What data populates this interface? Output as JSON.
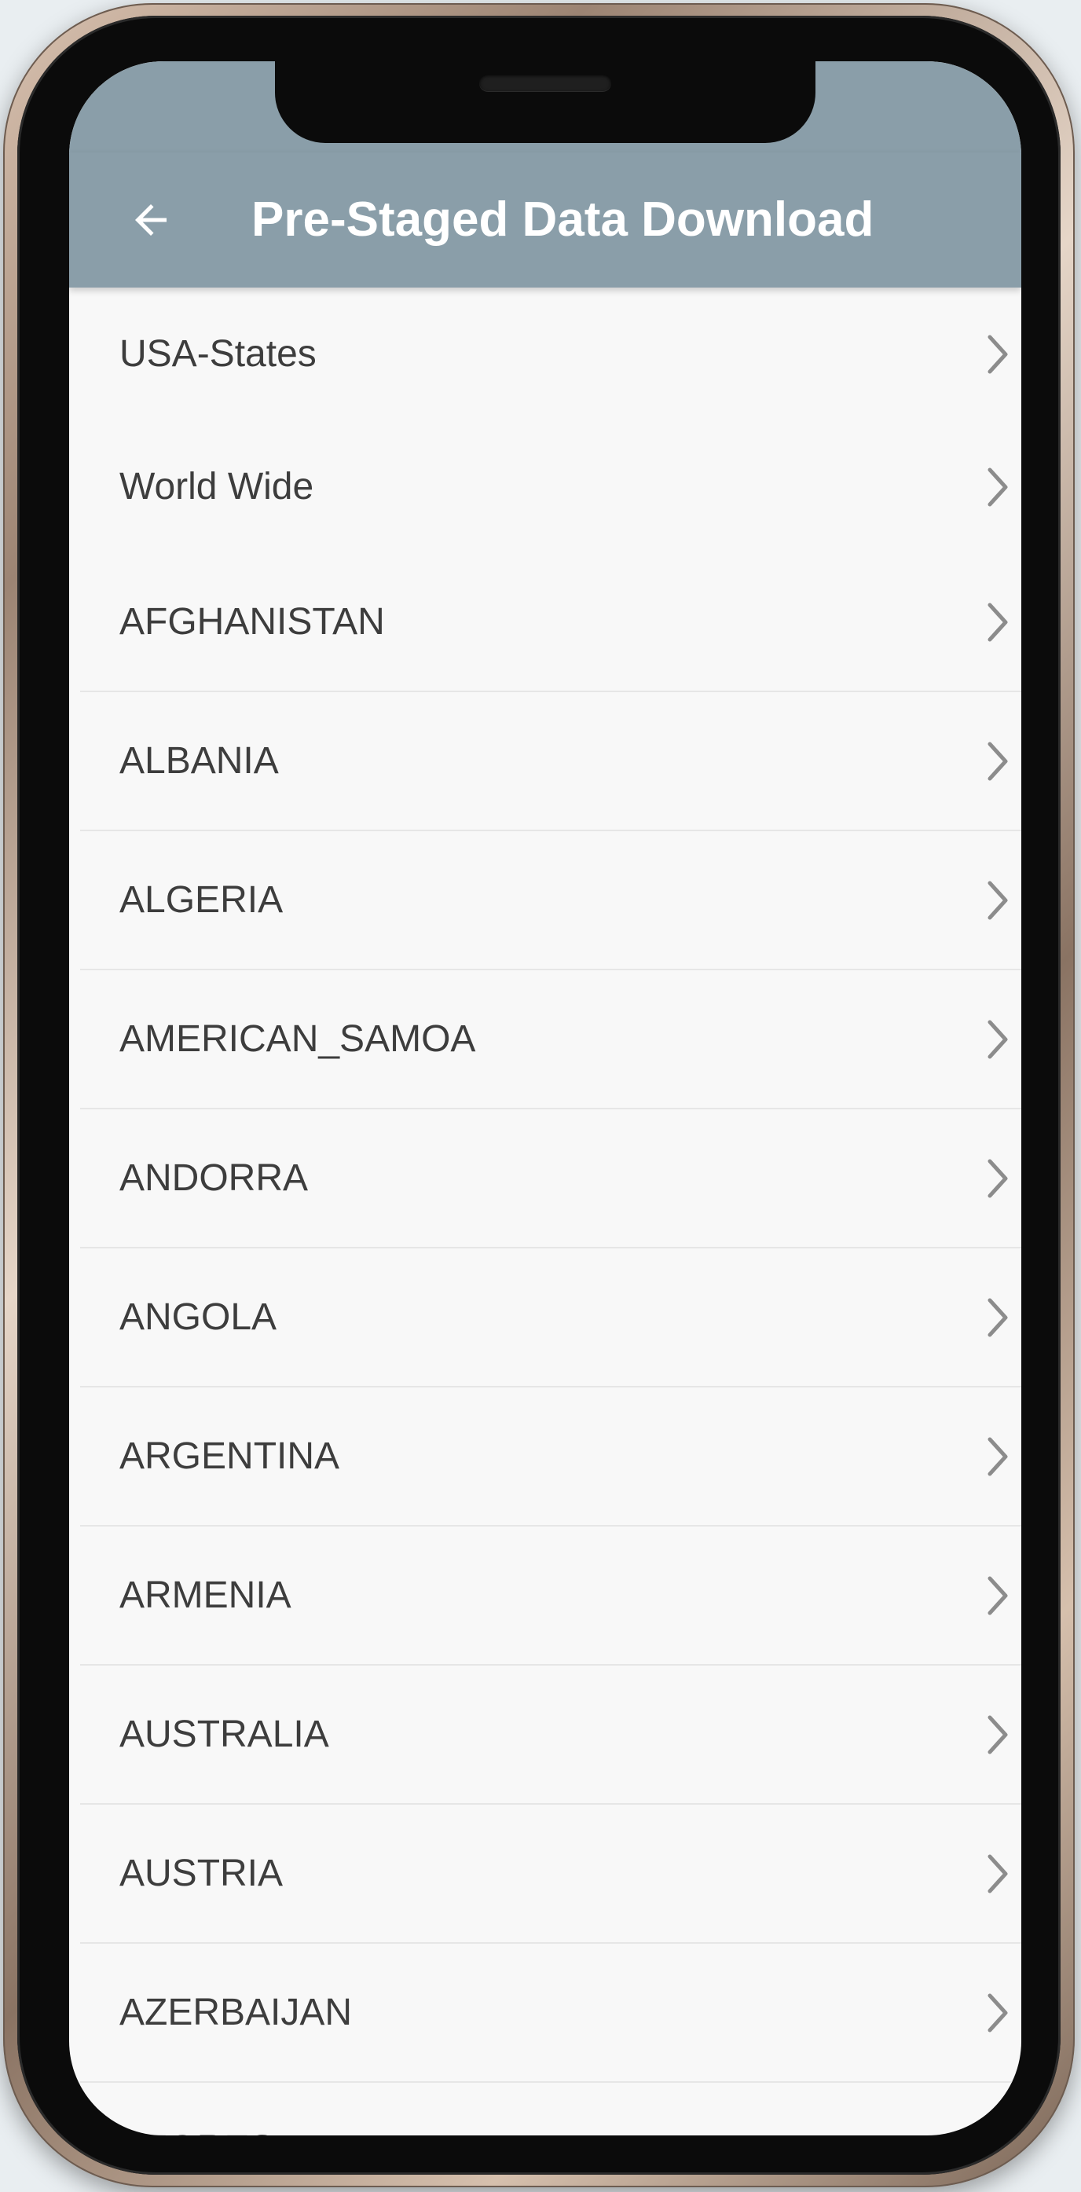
{
  "app_bar": {
    "title": "Pre-Staged Data Download",
    "back_icon": "arrow-back-icon"
  },
  "colors": {
    "app_bar": "#8a9ea9",
    "list_bg": "#f8f8f8",
    "text": "#3d3d3d",
    "chevron": "#8c8c8c"
  },
  "list": {
    "items": [
      {
        "label": "USA-States"
      },
      {
        "label": "World Wide"
      },
      {
        "label": "AFGHANISTAN"
      },
      {
        "label": "ALBANIA"
      },
      {
        "label": "ALGERIA"
      },
      {
        "label": "AMERICAN_SAMOA"
      },
      {
        "label": "ANDORRA"
      },
      {
        "label": "ANGOLA"
      },
      {
        "label": "ARGENTINA"
      },
      {
        "label": "ARMENIA"
      },
      {
        "label": "AUSTRALIA"
      },
      {
        "label": "AUSTRIA"
      },
      {
        "label": "AZERBAIJAN"
      },
      {
        "label": "AZORES"
      }
    ],
    "item_icon": "chevron-right-icon"
  }
}
